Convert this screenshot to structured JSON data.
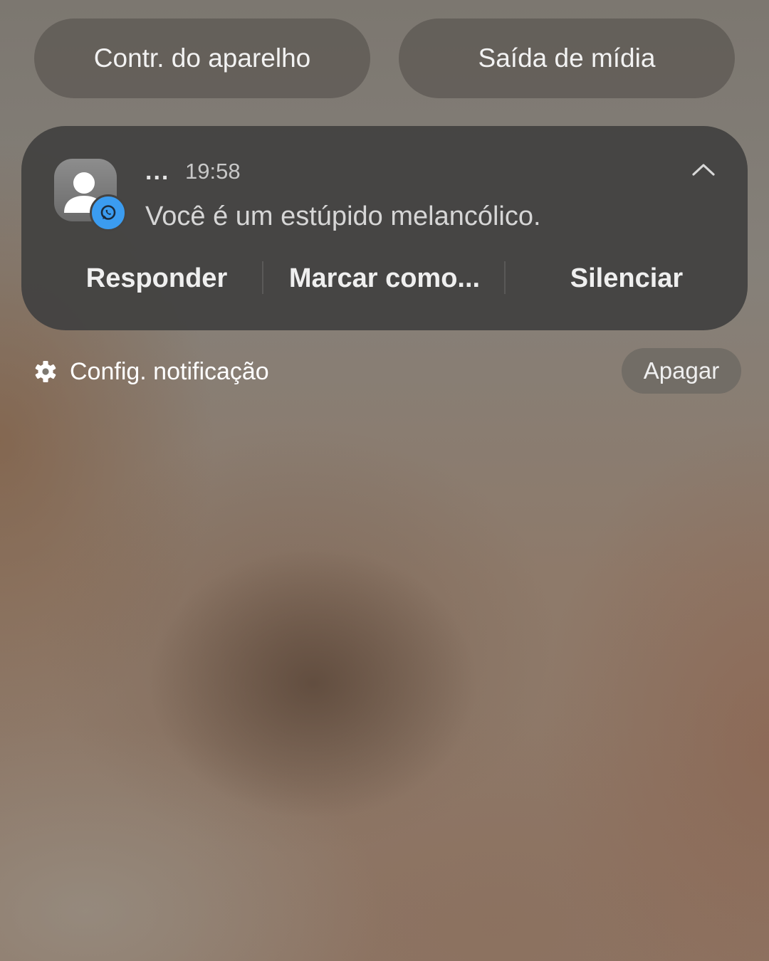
{
  "quick_panel": {
    "device_control_label": "Contr. do aparelho",
    "media_output_label": "Saída de mídia"
  },
  "notification": {
    "app_icon": "person-icon",
    "badge_icon": "whatsapp-icon",
    "sender_placeholder": "...",
    "time": "19:58",
    "message": "Você é um estúpido melancólico.",
    "expand_icon": "chevron-up-icon",
    "actions": [
      {
        "label": "Responder"
      },
      {
        "label": "Marcar como..."
      },
      {
        "label": "Silenciar"
      }
    ],
    "badge_color": "#3b9cf0"
  },
  "footer": {
    "settings_icon": "gear-icon",
    "settings_label": "Config. notificação",
    "clear_label": "Apagar"
  }
}
